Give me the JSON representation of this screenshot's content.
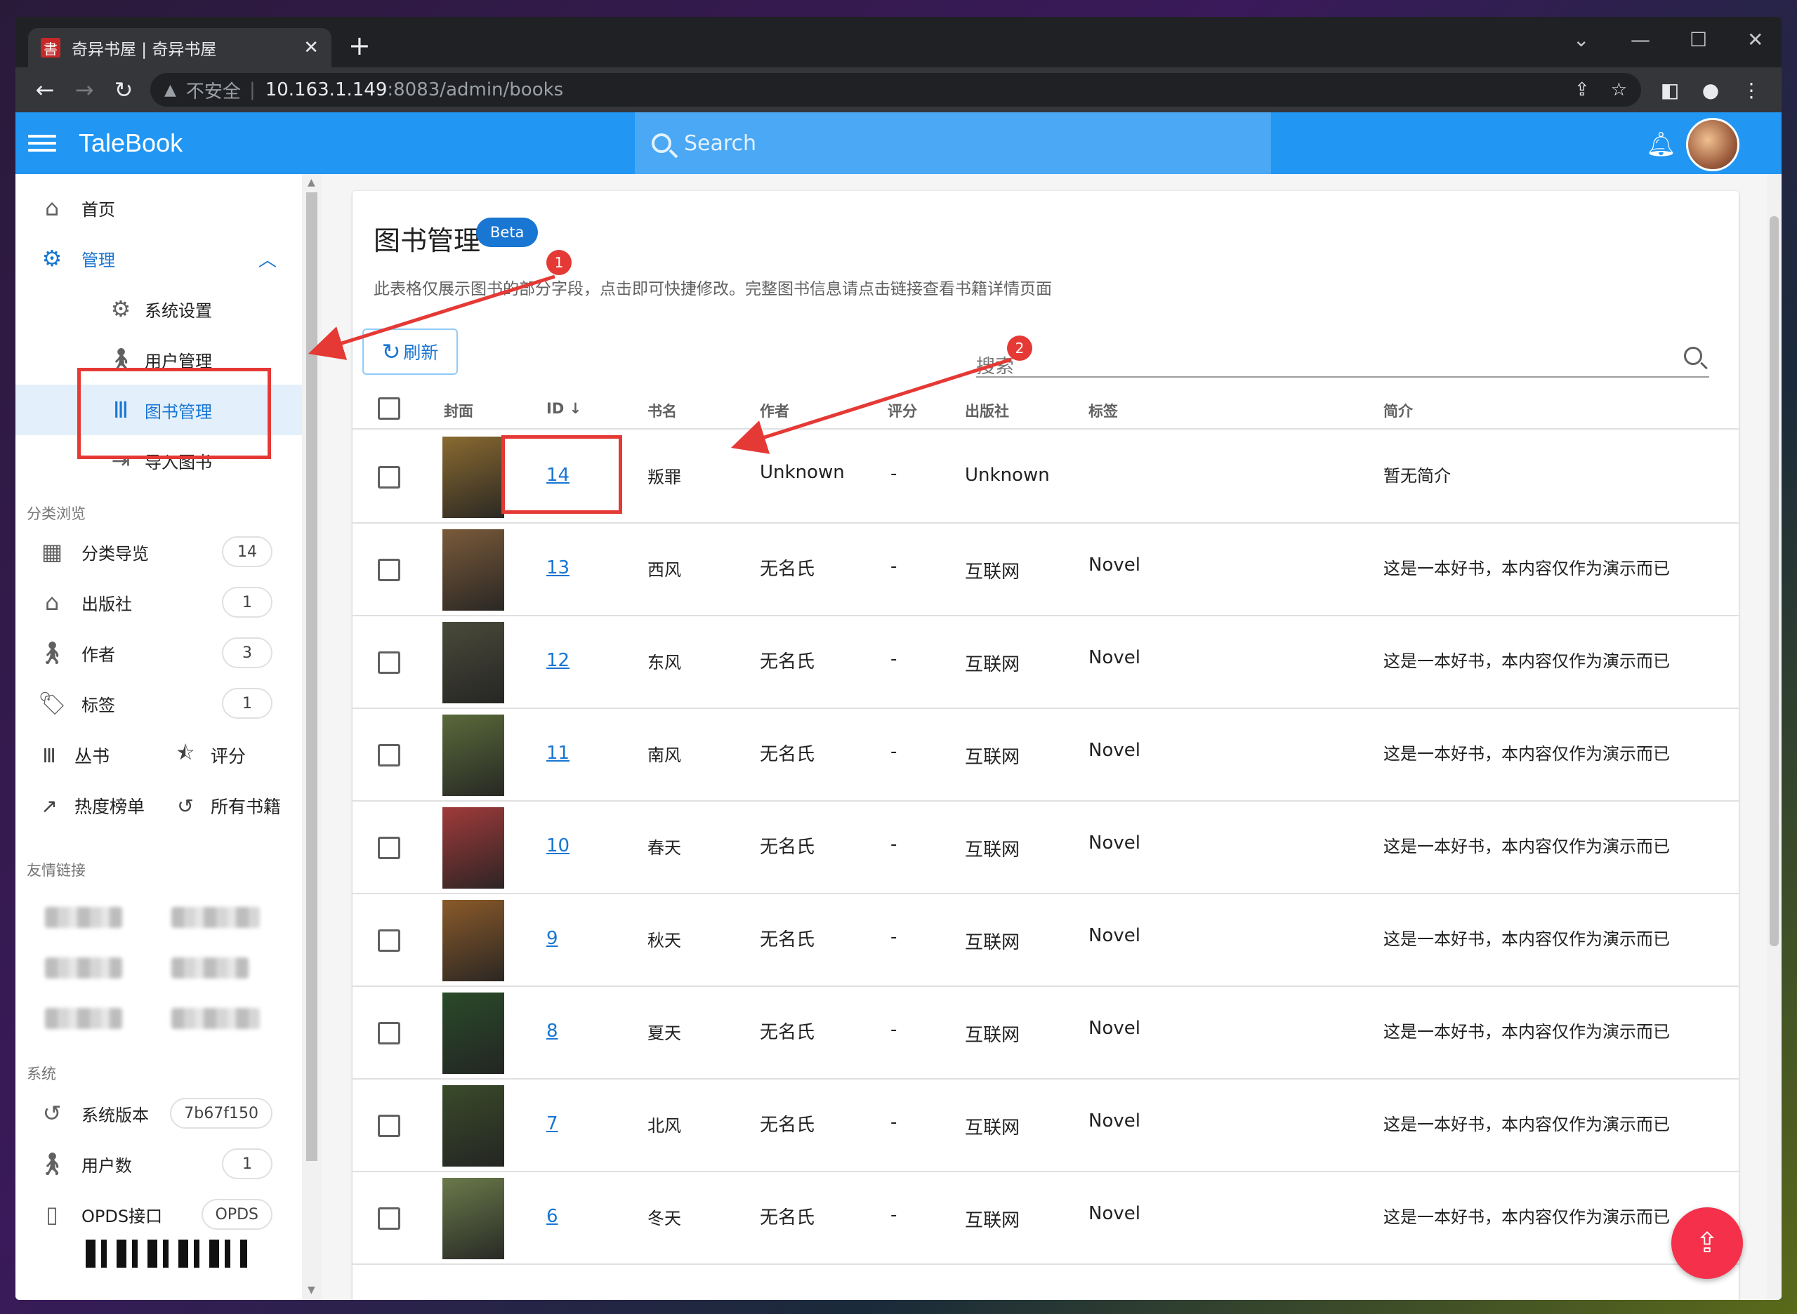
{
  "browser": {
    "tab_title": "奇异书屋 | 奇异书屋",
    "tab_favicon": "書",
    "new_tab": "+",
    "insecure_label": "不安全",
    "url_host": "10.163.1.149",
    "url_rest": ":8083/admin/books"
  },
  "app": {
    "brand": "TaleBook",
    "search_placeholder": "Search"
  },
  "sidebar": {
    "home": "首页",
    "manage": "管理",
    "sub_items": [
      "系统设置",
      "用户管理",
      "图书管理",
      "导入图书"
    ],
    "section_browse": "分类浏览",
    "browse_items": [
      {
        "label": "分类导览",
        "count": "14"
      },
      {
        "label": "出版社",
        "count": "1"
      },
      {
        "label": "作者",
        "count": "3"
      },
      {
        "label": "标签",
        "count": "1"
      }
    ],
    "series": "丛书",
    "rating": "评分",
    "hot": "热度榜单",
    "all_books": "所有书籍",
    "section_links": "友情链接",
    "section_system": "系统",
    "system_items": [
      {
        "label": "系统版本",
        "count": "7b67f150"
      },
      {
        "label": "用户数",
        "count": "1"
      },
      {
        "label": "OPDS接口",
        "count": "OPDS"
      }
    ]
  },
  "page": {
    "title": "图书管理",
    "badge": "Beta",
    "subtitle": "此表格仅展示图书的部分字段，点击即可快捷修改。完整图书信息请点击链接查看书籍详情页面",
    "refresh": "刷新",
    "search_placeholder": "搜索"
  },
  "table": {
    "headers": [
      "封面",
      "ID",
      "书名",
      "作者",
      "评分",
      "出版社",
      "标签",
      "简介"
    ],
    "rows": [
      {
        "id": "14",
        "title": "叛罪",
        "author": "Unknown",
        "rating": "-",
        "publisher": "Unknown",
        "tags": "",
        "summary": "暂无简介",
        "cover": "#8a6a30"
      },
      {
        "id": "13",
        "title": "西风",
        "author": "无名氏",
        "rating": "-",
        "publisher": "互联网",
        "tags": "Novel",
        "summary": "这是一本好书，本内容仅作为演示而已",
        "cover": "#7a5a3a"
      },
      {
        "id": "12",
        "title": "东风",
        "author": "无名氏",
        "rating": "-",
        "publisher": "互联网",
        "tags": "Novel",
        "summary": "这是一本好书，本内容仅作为演示而已",
        "cover": "#4a4a3a"
      },
      {
        "id": "11",
        "title": "南风",
        "author": "无名氏",
        "rating": "-",
        "publisher": "互联网",
        "tags": "Novel",
        "summary": "这是一本好书，本内容仅作为演示而已",
        "cover": "#5a6a3a"
      },
      {
        "id": "10",
        "title": "春天",
        "author": "无名氏",
        "rating": "-",
        "publisher": "互联网",
        "tags": "Novel",
        "summary": "这是一本好书，本内容仅作为演示而已",
        "cover": "#a03a3a"
      },
      {
        "id": "9",
        "title": "秋天",
        "author": "无名氏",
        "rating": "-",
        "publisher": "互联网",
        "tags": "Novel",
        "summary": "这是一本好书，本内容仅作为演示而已",
        "cover": "#8a5a2a"
      },
      {
        "id": "8",
        "title": "夏天",
        "author": "无名氏",
        "rating": "-",
        "publisher": "互联网",
        "tags": "Novel",
        "summary": "这是一本好书，本内容仅作为演示而已",
        "cover": "#2a4a2a"
      },
      {
        "id": "7",
        "title": "北风",
        "author": "无名氏",
        "rating": "-",
        "publisher": "互联网",
        "tags": "Novel",
        "summary": "这是一本好书，本内容仅作为演示而已",
        "cover": "#3a4a2a"
      },
      {
        "id": "6",
        "title": "冬天",
        "author": "无名氏",
        "rating": "-",
        "publisher": "互联网",
        "tags": "Novel",
        "summary": "这是一本好书，本内容仅作为演示而已",
        "cover": "#6a7a4a"
      }
    ]
  },
  "annotations": [
    "1",
    "2"
  ]
}
